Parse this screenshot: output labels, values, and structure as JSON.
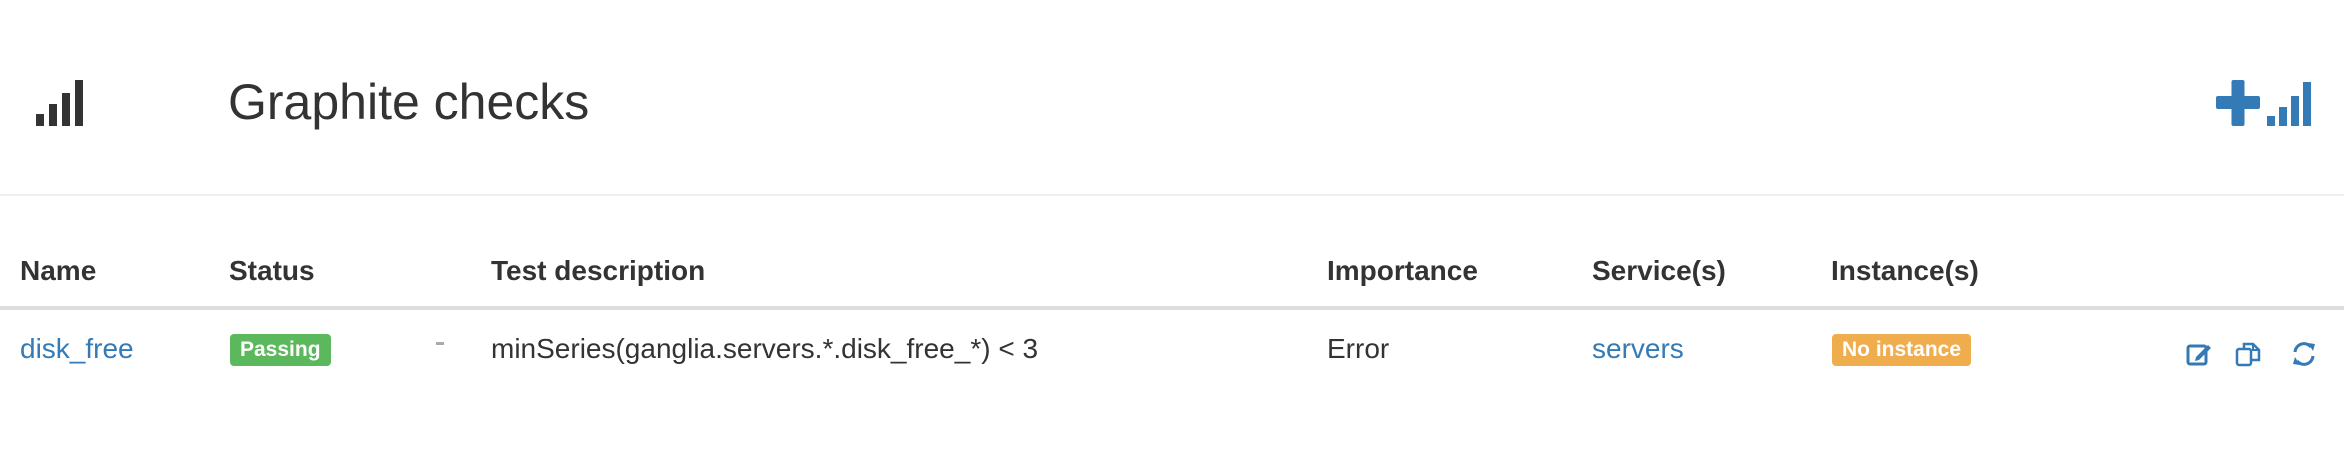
{
  "header": {
    "title": "Graphite checks",
    "icon": "signal-icon",
    "add_button_icon": "plus-signal-icon"
  },
  "table": {
    "columns": [
      "Name",
      "Status",
      "Test description",
      "Importance",
      "Service(s)",
      "Instance(s)"
    ],
    "rows": [
      {
        "name": "disk_free",
        "status": "Passing",
        "test_description": "minSeries(ganglia.servers.*.disk_free_*) < 3",
        "importance": "Error",
        "services": "servers",
        "instances": "No instance",
        "actions": [
          "edit-icon",
          "duplicate-icon",
          "refresh-icon"
        ]
      }
    ]
  },
  "colors": {
    "link": "#337ab7",
    "passing": "#5cb85c",
    "warning": "#f0ad4e",
    "text": "#333333"
  }
}
